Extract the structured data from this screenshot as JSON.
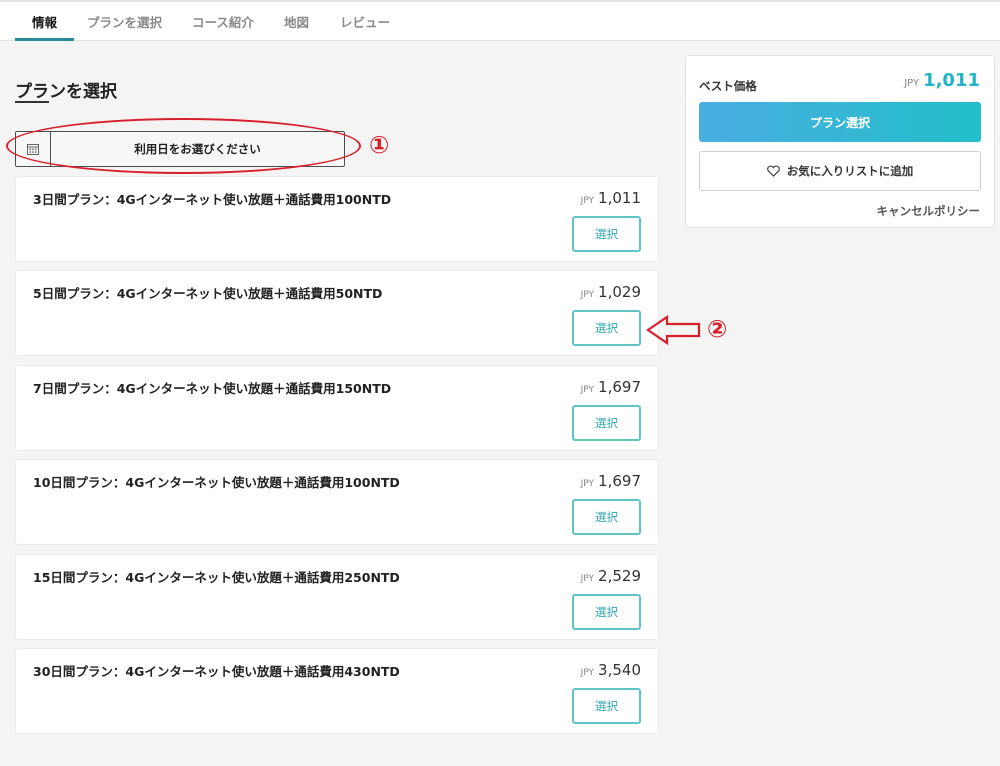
{
  "tabs": [
    {
      "label": "情報",
      "active": true
    },
    {
      "label": "プランを選択",
      "active": false
    },
    {
      "label": "コース紹介",
      "active": false
    },
    {
      "label": "地図",
      "active": false
    },
    {
      "label": "レビュー",
      "active": false
    }
  ],
  "section": {
    "title": "プランを選択"
  },
  "date_picker": {
    "label": "利用日をお選びください",
    "icon": "calendar-icon"
  },
  "annotations": [
    "①",
    "②"
  ],
  "plans": [
    {
      "name": "3日間プラン：4Gインターネット使い放題＋通話費用100NTD",
      "currency": "JPY",
      "price": "1,011",
      "button": "選択"
    },
    {
      "name": "5日間プラン：4Gインターネット使い放題＋通話費用50NTD",
      "currency": "JPY",
      "price": "1,029",
      "button": "選択"
    },
    {
      "name": "7日間プラン：4Gインターネット使い放題＋通話費用150NTD",
      "currency": "JPY",
      "price": "1,697",
      "button": "選択"
    },
    {
      "name": "10日間プラン：4Gインターネット使い放題＋通話費用100NTD",
      "currency": "JPY",
      "price": "1,697",
      "button": "選択"
    },
    {
      "name": "15日間プラン：4Gインターネット使い放題＋通話費用250NTD",
      "currency": "JPY",
      "price": "2,529",
      "button": "選択"
    },
    {
      "name": "30日間プラン：4Gインターネット使い放題＋通話費用430NTD",
      "currency": "JPY",
      "price": "3,540",
      "button": "選択"
    }
  ],
  "side_panel": {
    "best_label": "ベスト価格",
    "currency": "JPY",
    "best_price": "1,011",
    "select_button": "プラン選択",
    "favorite_button": "お気に入りリストに追加",
    "cancel_policy": "キャンセルポリシー"
  },
  "colors": {
    "accent": "#22b4c4",
    "annotation": "#d8202a",
    "button_border": "#5fc4c4"
  }
}
